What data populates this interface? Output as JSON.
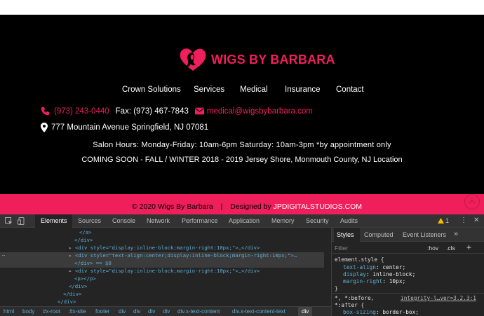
{
  "site": {
    "brand": "WIGS BY BARBARA",
    "nav": [
      "Crown Solutions",
      "Services",
      "Medical",
      "Insurance",
      "Contact"
    ],
    "phone": "(973) 243-0440",
    "fax": "Fax: (973) 467-7843",
    "email": "medical@wigsbybarbara.com",
    "address": "777 Mountain Avenue Springfield, NJ 07081",
    "hours": "Salon Hours: Monday-Friday: 10am-6pm Saturday: 10am-3pm  *by appointment only",
    "coming_soon": "COMING SOON - FALL / WINTER 2018 - 2019 Jersey Shore, Monmouth County, NJ Location",
    "copyright": "© 2020 Wigs By Barbara",
    "separator": "|",
    "designed_by": "Designed by",
    "designer": "JPDIGITALSTUDIOS.COM"
  },
  "colors": {
    "accent": "#ee1f5a",
    "footer_bg": "#000000",
    "devtools_bg": "#242424"
  },
  "devtools": {
    "tabs": [
      "Elements",
      "Sources",
      "Console",
      "Network",
      "Performance",
      "Application",
      "Memory",
      "Security",
      "Audits"
    ],
    "warning_count": "1",
    "dom_lines": [
      "</a>",
      "</div>",
      "<div style=\"display:inline-block;margin-right:10px;\">…</div>",
      "<div style=\"text-align:center;display:inline-block;margin-right:10px;\">…",
      "</div> == $0",
      "<div style=\"display:inline-block;margin-right:10px;\">…</div>",
      "<p></p>",
      "</div>",
      "</div>",
      "</div>"
    ],
    "styles_tabs": [
      "Styles",
      "Computed",
      "Event Listeners"
    ],
    "more_tabs": "»",
    "filter_placeholder": "Filter",
    "hov": ":hov",
    "cls": ".cls",
    "add": "+",
    "element_style": "element.style {",
    "rules": [
      {
        "prop": "text-align",
        "value": "center;"
      },
      {
        "prop": "display",
        "value": "inline-block;"
      },
      {
        "prop": "margin-right",
        "value": "10px;"
      }
    ],
    "close_brace": "}",
    "selector2": "*, *:before,",
    "selector2b": "*:after {",
    "source_link": "integrity-l…ver=3.2.3:1",
    "rule2_prop": "box-sizing",
    "rule2_value": "border-box;",
    "breadcrumb": [
      "html",
      "body",
      "#x-root",
      "#x-site",
      "footer",
      "div",
      "div",
      "div",
      "div",
      "div.x-text-content",
      "div.x-text-content-text",
      "div"
    ]
  }
}
